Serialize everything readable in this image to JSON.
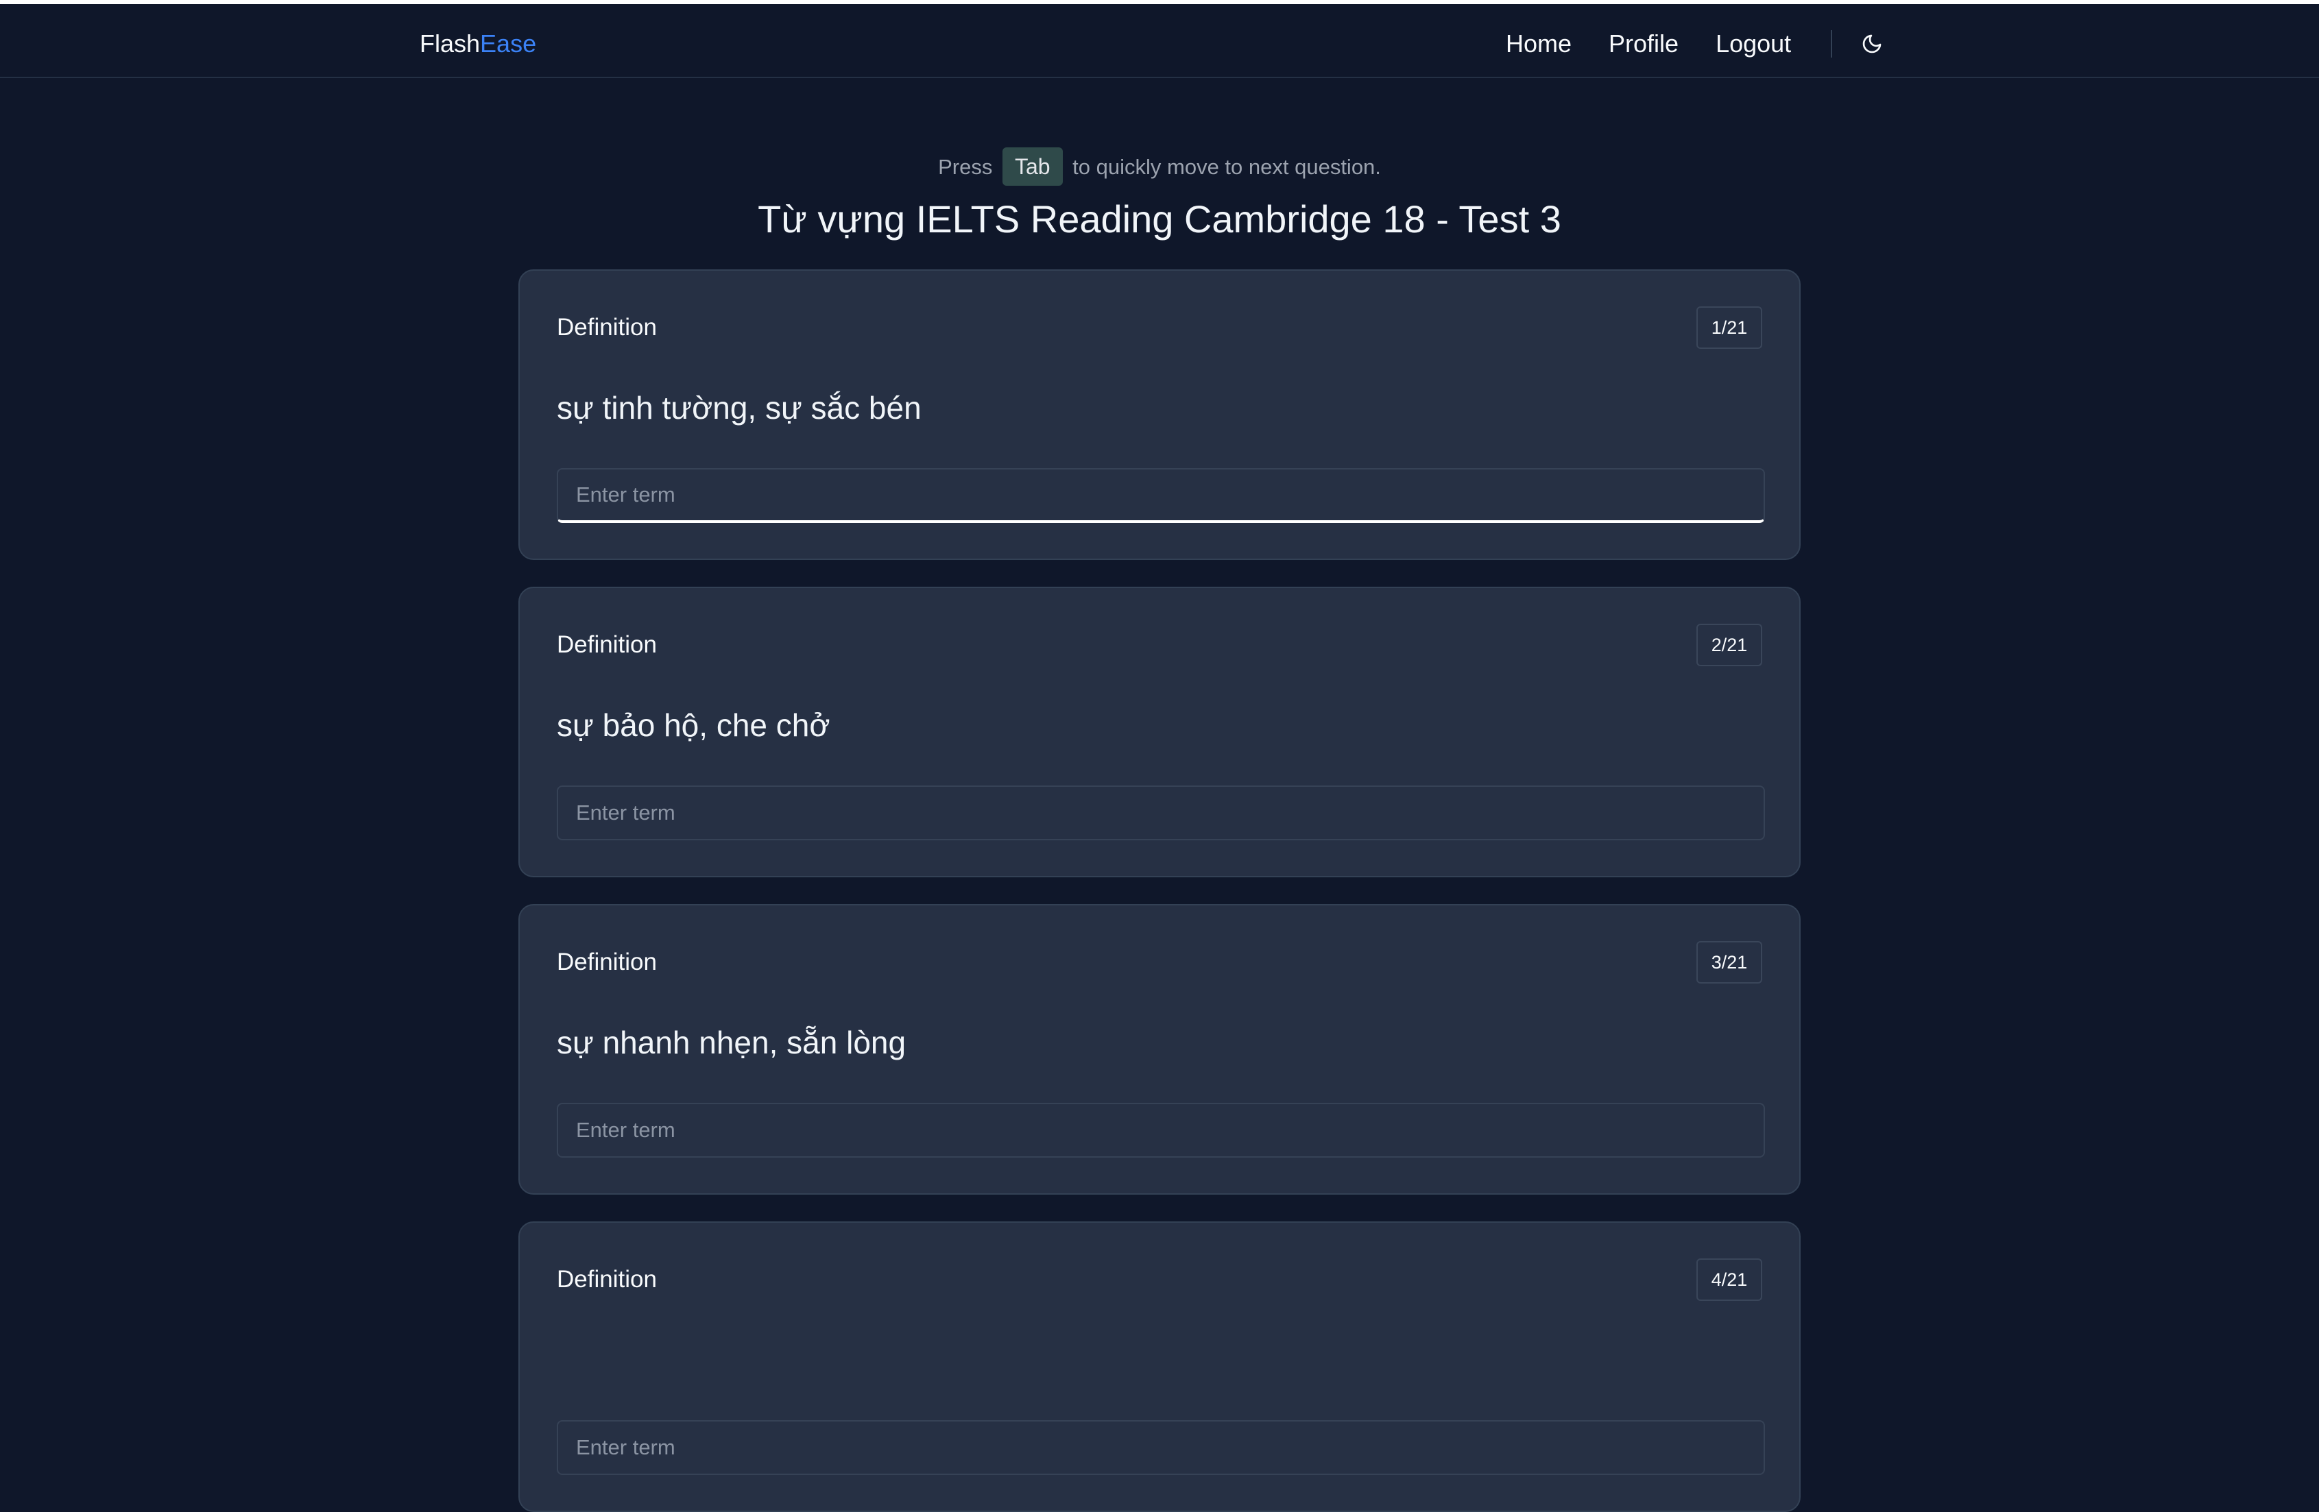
{
  "brand": {
    "part1": "Flash",
    "part2": "Ease"
  },
  "nav": {
    "home": "Home",
    "profile": "Profile",
    "logout": "Logout",
    "theme_icon": "moon-icon"
  },
  "hint": {
    "before": "Press",
    "key": "Tab",
    "after": "to quickly move to next question."
  },
  "title": "Từ vựng IELTS Reading Cambridge 18 - Test 3",
  "cards": [
    {
      "label": "Definition",
      "count": "1/21",
      "definition": "sự tinh tường, sự sắc bén",
      "placeholder": "Enter term",
      "value": ""
    },
    {
      "label": "Definition",
      "count": "2/21",
      "definition": "sự bảo hộ, che chở",
      "placeholder": "Enter term",
      "value": ""
    },
    {
      "label": "Definition",
      "count": "3/21",
      "definition": "sự nhanh nhẹn, sẵn lòng",
      "placeholder": "Enter term",
      "value": ""
    },
    {
      "label": "Definition",
      "count": "4/21",
      "definition": "",
      "placeholder": "Enter term",
      "value": ""
    }
  ],
  "colors": {
    "background": "#0f172a",
    "card": "#263044",
    "accent": "#3b82f6",
    "kbd": "#2f4a4a"
  }
}
